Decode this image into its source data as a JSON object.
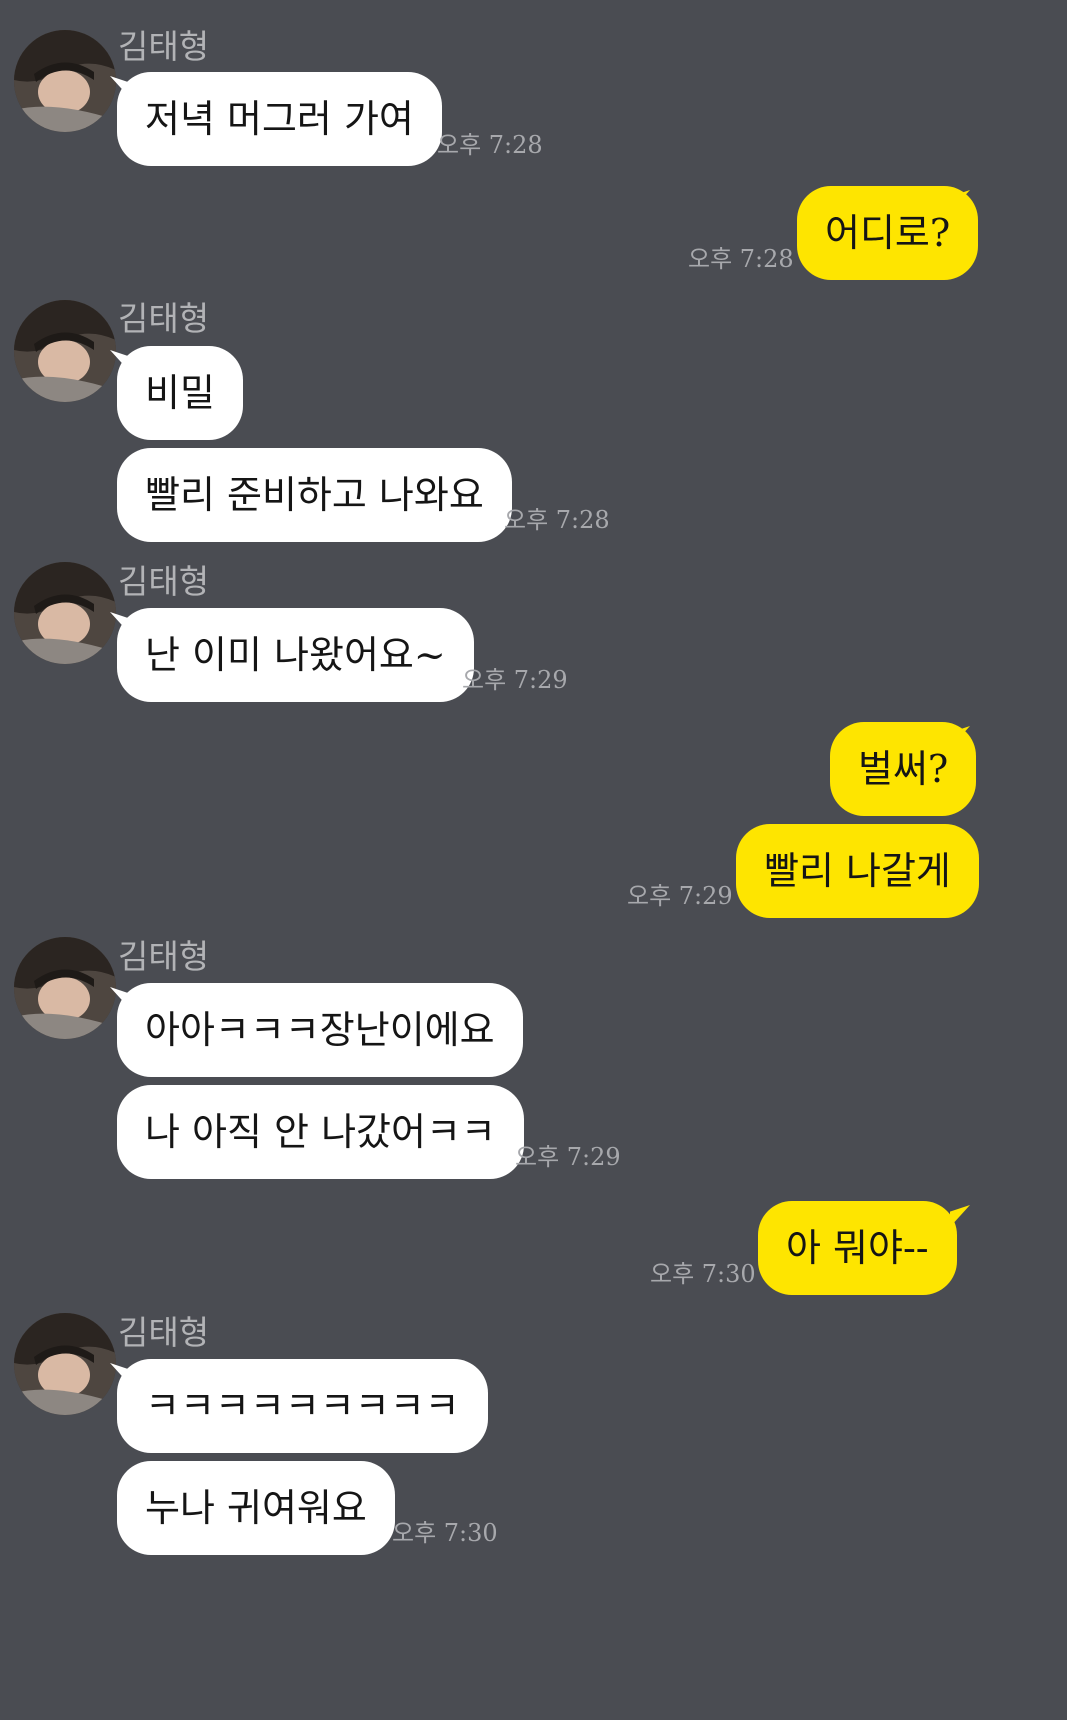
{
  "colors": {
    "background": "#4a4c52",
    "incoming_bubble": "#ffffff",
    "outgoing_bubble": "#fee500",
    "meta_text": "#a7a8ac"
  },
  "contact": {
    "name": "김태형",
    "avatar_icon": "profile-photo"
  },
  "messages": [
    {
      "id": "m1",
      "side": "in",
      "text": "저녁 머그러 가여",
      "time": "오후 7:28"
    },
    {
      "id": "m2",
      "side": "out",
      "text": "어디로?",
      "time": "오후 7:28"
    },
    {
      "id": "m3",
      "side": "in",
      "text": "비밀",
      "time": ""
    },
    {
      "id": "m4",
      "side": "in",
      "text": "빨리 준비하고 나와요",
      "time": "오후 7:28"
    },
    {
      "id": "m5",
      "side": "in",
      "text": "난 이미 나왔어요~",
      "time": "오후 7:29"
    },
    {
      "id": "m6",
      "side": "out",
      "text": "벌써?",
      "time": ""
    },
    {
      "id": "m7",
      "side": "out",
      "text": "빨리 나갈게",
      "time": "오후 7:29"
    },
    {
      "id": "m8",
      "side": "in",
      "text": "아아ㅋㅋㅋ장난이에요",
      "time": ""
    },
    {
      "id": "m9",
      "side": "in",
      "text": "나 아직 안 나갔어ㅋㅋ",
      "time": "오후 7:29"
    },
    {
      "id": "m10",
      "side": "out",
      "text": "아 뭐야--",
      "time": "오후 7:30"
    },
    {
      "id": "m11",
      "side": "in",
      "text": "ㅋㅋㅋㅋㅋㅋㅋㅋㅋ",
      "time": ""
    },
    {
      "id": "m12",
      "side": "in",
      "text": "누나 귀여워요",
      "time": "오후 7:30"
    }
  ]
}
